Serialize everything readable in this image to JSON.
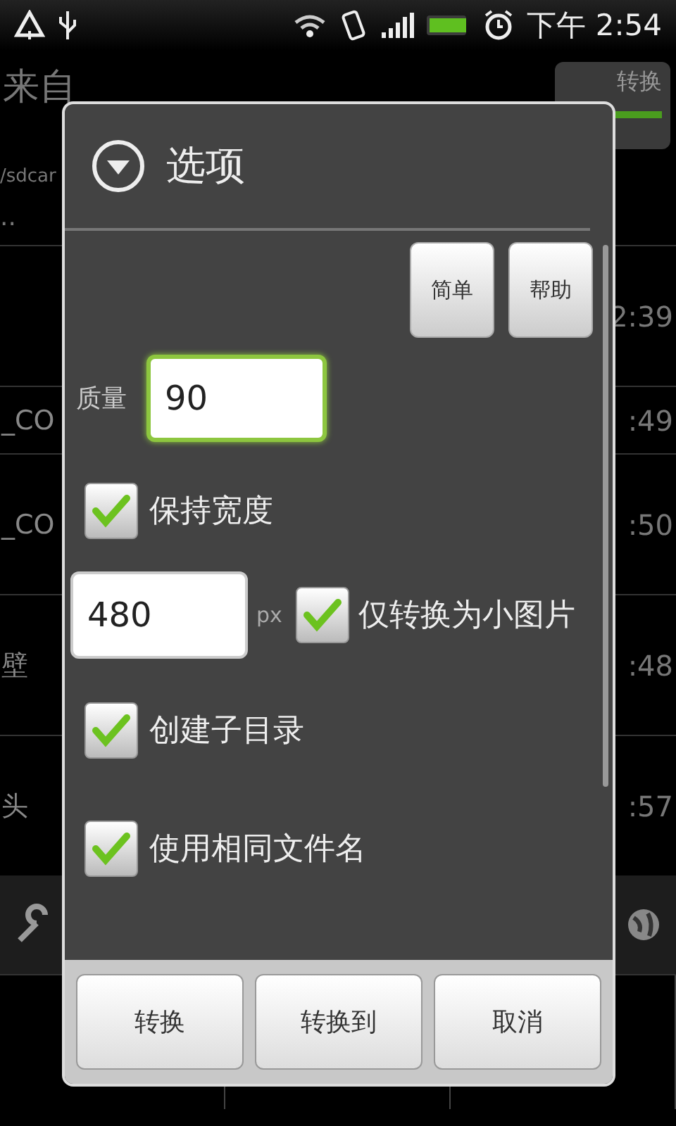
{
  "status_bar": {
    "time": "下午 2:54"
  },
  "background": {
    "header": "来自",
    "convert_button": "转换",
    "path": "/sdcar",
    "parent": "..",
    "rows": [
      {
        "name": "",
        "time": "2:39"
      },
      {
        "name": "_CO",
        "time": ":49"
      },
      {
        "name": "_CO",
        "time": ":50"
      },
      {
        "name": "壁",
        "time": ":48"
      },
      {
        "name": "头",
        "time": ":57"
      }
    ]
  },
  "dialog": {
    "title": "选项",
    "top_buttons": [
      "简单",
      "帮助"
    ],
    "quality": {
      "label": "质量",
      "value": "90",
      "focused": true
    },
    "options": [
      {
        "kind": "checkbox",
        "label": "保持宽度",
        "checked": true
      },
      {
        "kind": "width",
        "value": "480",
        "unit": "px",
        "label": "仅转换为小图片",
        "checked": true
      },
      {
        "kind": "checkbox",
        "label": "创建子目录",
        "checked": true
      },
      {
        "kind": "checkbox",
        "label": "使用相同文件名",
        "checked": true
      }
    ],
    "buttons": [
      "转换",
      "转换到",
      "取消"
    ]
  }
}
